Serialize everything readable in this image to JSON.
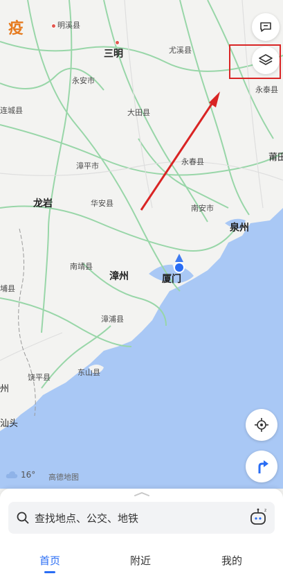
{
  "badge": "疫",
  "places": {
    "mingxi": "明溪县",
    "sanming": "三明",
    "youxi": "尤溪县",
    "yongan": "永安市",
    "yongtai": "永泰县",
    "liancheng": "连城县",
    "datian": "大田县",
    "putian": "莆田",
    "zhangping": "漳平市",
    "yongchun": "永春县",
    "longyan": "龙岩",
    "huaan": "华安县",
    "nanan": "南安市",
    "quanzhou": "泉州",
    "nanjing": "南靖县",
    "zhangzhou": "漳州",
    "xiamen": "厦门",
    "pu": "埔县",
    "zhangpu": "漳浦县",
    "dongshan": "东山县",
    "raoping": "饶平县",
    "zhou": "州",
    "shantou": "汕头"
  },
  "weather": {
    "temp": "16°",
    "icon": "cloud-icon"
  },
  "map_logo": "高德地图",
  "search": {
    "placeholder": "查找地点、公交、地铁"
  },
  "tabs": {
    "home": "首页",
    "nearby": "附近",
    "mine": "我的"
  },
  "colors": {
    "accent": "#2a6df4",
    "sea": "#a9c8f5",
    "highlight": "#d92424"
  }
}
